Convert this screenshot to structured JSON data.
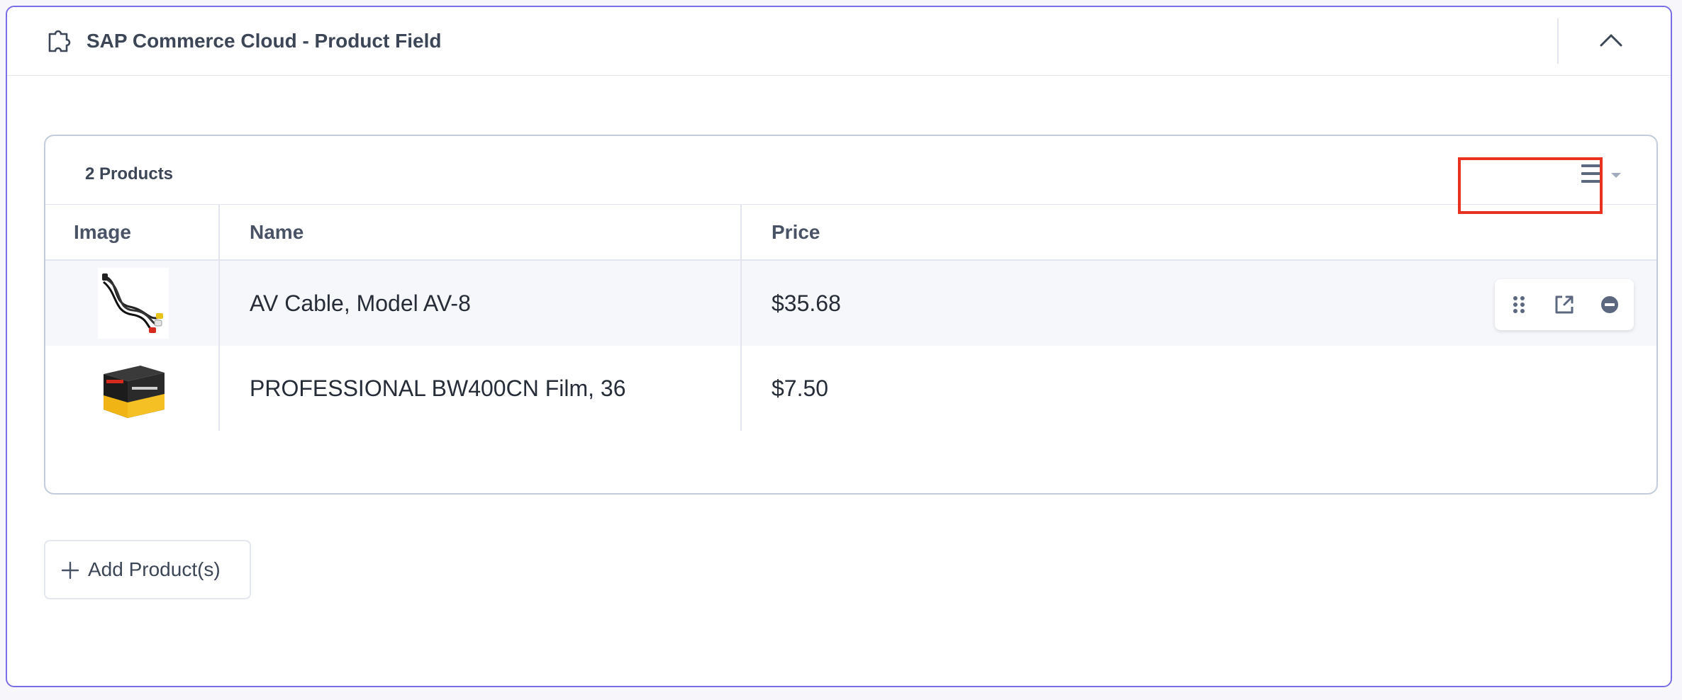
{
  "panel": {
    "title": "SAP Commerce Cloud - Product Field",
    "icons": {
      "field": "puzzle-icon",
      "collapse": "chevron-up-icon"
    }
  },
  "table": {
    "count_label": "2 Products",
    "columns": [
      "Image",
      "Name",
      "Price"
    ],
    "rows": [
      {
        "image": "av-cable-thumbnail",
        "name": "AV Cable, Model AV-8",
        "price": "$35.68"
      },
      {
        "image": "film-box-thumbnail",
        "name": "PROFESSIONAL BW400CN Film, 36",
        "price": "$7.50"
      }
    ],
    "row_actions": [
      "drag-handle-icon",
      "open-external-icon",
      "remove-icon"
    ],
    "menu_icon": "list-menu-icon"
  },
  "add_button": {
    "label": "Add Product(s)",
    "icon": "plus-icon"
  },
  "colors": {
    "panel_border": "#7a6ee6",
    "highlight": "#e8321f",
    "icon": "#5c6880"
  }
}
